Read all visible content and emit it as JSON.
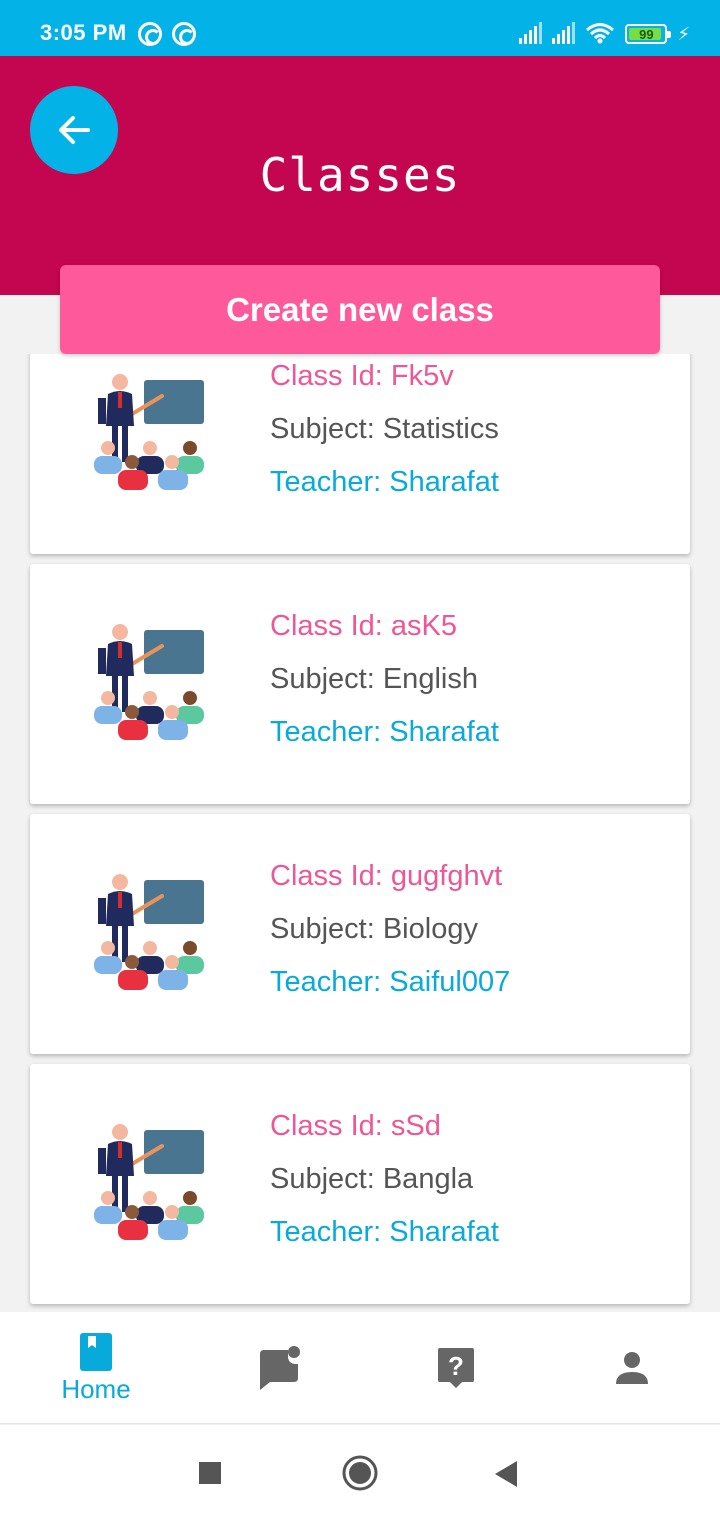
{
  "status_bar": {
    "time": "3:05 PM",
    "battery_level": "99",
    "background_color": "#03b3e8"
  },
  "header": {
    "title": "Classes",
    "back_icon": "arrow-left-icon",
    "background_color": "#c40550"
  },
  "create_button": {
    "label": "Create new class",
    "color": "#fe5a9b"
  },
  "classes": [
    {
      "class_id": "Class Id: Fk5v",
      "subject": "Subject: Statistics",
      "teacher": "Teacher: Sharafat"
    },
    {
      "class_id": "Class Id: asK5",
      "subject": "Subject: English",
      "teacher": "Teacher: Sharafat"
    },
    {
      "class_id": "Class Id: gugfghvt",
      "subject": "Subject: Biology",
      "teacher": "Teacher: Saiful007"
    },
    {
      "class_id": "Class Id: sSd",
      "subject": "Subject: Bangla",
      "teacher": "Teacher: Sharafat"
    }
  ],
  "bottom_nav": {
    "home_label": "Home",
    "items": [
      "book-icon",
      "chat-icon",
      "help-icon",
      "person-icon"
    ],
    "active_color": "#08aadc",
    "inactive_color": "#666666"
  },
  "system_nav": [
    "recents-square-icon",
    "home-circle-icon",
    "back-triangle-icon"
  ]
}
